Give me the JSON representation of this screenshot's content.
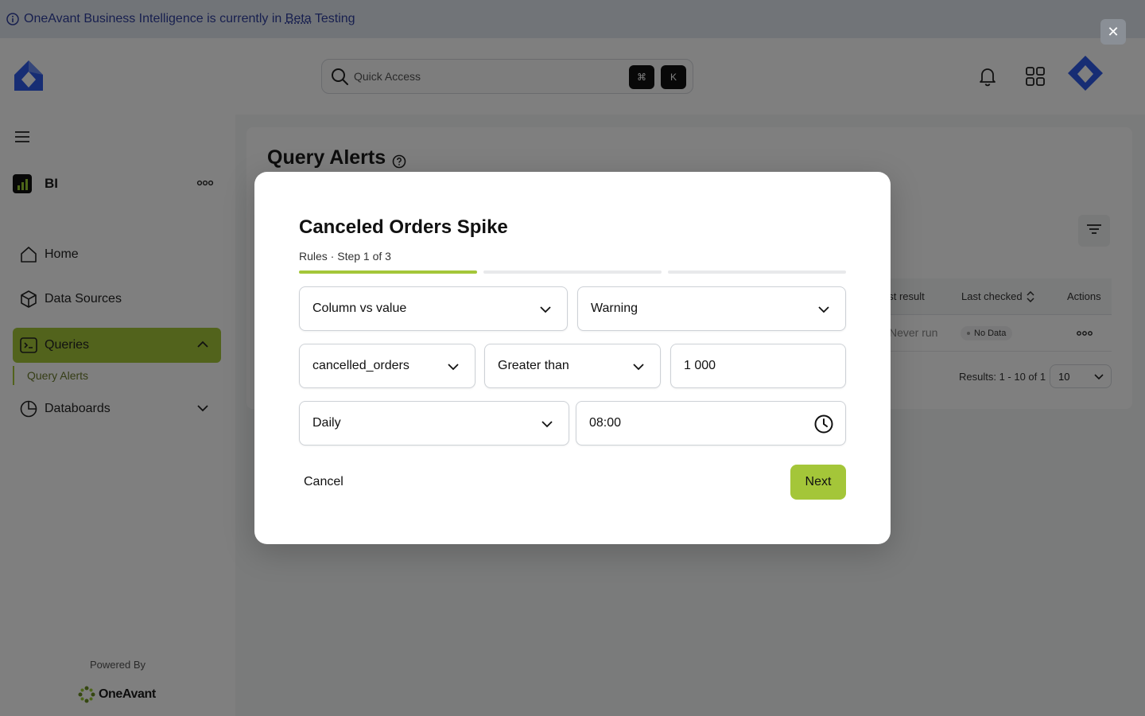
{
  "banner": {
    "text_before": "OneAvant Business Intelligence is currently in",
    "beta": "Beta",
    "text_after": "Testing",
    "close_label": "✕"
  },
  "topbar": {
    "search_placeholder": "Quick Access",
    "shortcut_cmd": "⌘",
    "shortcut_key": "K"
  },
  "sidebar": {
    "workspace": "BI",
    "items": [
      {
        "label": "Home",
        "icon": "home-icon"
      },
      {
        "label": "Data Sources",
        "icon": "cube-icon"
      },
      {
        "label": "Queries",
        "icon": "terminal-icon",
        "active": true
      },
      {
        "label": "Databoards",
        "icon": "pie-chart-icon"
      }
    ],
    "sub_item": "Query Alerts",
    "powered_by": "Powered By",
    "brand": "OneAvant"
  },
  "main": {
    "title": "Query Alerts",
    "columns": [
      "ast result",
      "Last checked",
      "Actions"
    ],
    "row": {
      "last_result": "Never run",
      "status": "No Data"
    },
    "results_text": "Results: 1 - 10 of 1",
    "per_page": "10"
  },
  "modal": {
    "title": "Canceled Orders Spike",
    "subtitle": "Rules · Step 1 of 3",
    "steps_total": 3,
    "step_current": 1,
    "rule_type": "Column vs value",
    "severity": "Warning",
    "column": "cancelled_orders",
    "operator": "Greater than",
    "threshold": "1 000",
    "frequency": "Daily",
    "time": "08:00",
    "cancel_label": "Cancel",
    "next_label": "Next"
  },
  "colors": {
    "accent": "#a4c639",
    "brand_blue": "#2f5be8",
    "banner_text": "#2f3f9e"
  }
}
